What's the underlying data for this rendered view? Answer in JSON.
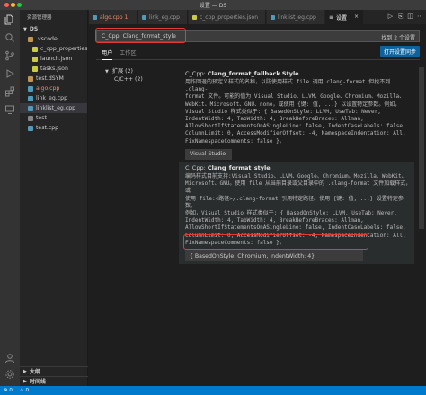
{
  "window": {
    "title": "设置 — DS"
  },
  "activity_icons": [
    "files-icon",
    "search-icon",
    "source-control-icon",
    "run-debug-icon",
    "extensions-icon",
    "remote-icon"
  ],
  "activity_bottom_icons": [
    "account-icon",
    "manage-gear-icon"
  ],
  "sidebar": {
    "header": "资源管理器",
    "folder": "DS",
    "items": [
      {
        "label": ".vscode",
        "kind": "folder",
        "indent": 1,
        "color": "#cccccc"
      },
      {
        "label": "c_cpp_properties.json",
        "kind": "json",
        "indent": 2,
        "color": "#cccccc"
      },
      {
        "label": "launch.json",
        "kind": "json",
        "indent": 2,
        "color": "#cccccc"
      },
      {
        "label": "tasks.json",
        "kind": "json",
        "indent": 2,
        "color": "#cccccc"
      },
      {
        "label": "test.dSYM",
        "kind": "folder",
        "indent": 1,
        "color": "#cccccc"
      },
      {
        "label": "algo.cpp",
        "kind": "cpp",
        "indent": 1,
        "color": "#f48771"
      },
      {
        "label": "link_eg.cpp",
        "kind": "cpp",
        "indent": 1,
        "color": "#cccccc"
      },
      {
        "label": "linklist_eg.cpp",
        "kind": "cpp",
        "indent": 1,
        "color": "#cccccc"
      },
      {
        "label": "test",
        "kind": "file",
        "indent": 1,
        "color": "#cccccc"
      },
      {
        "label": "test.cpp",
        "kind": "cpp",
        "indent": 1,
        "color": "#cccccc"
      }
    ],
    "outline": "大纲",
    "timeline": "时间线"
  },
  "tabs": [
    {
      "label": "algo.cpp 1",
      "color": "#f48771",
      "active": false
    },
    {
      "label": "link_eg.cpp",
      "color": "#969696",
      "active": false
    },
    {
      "label": "c_cpp_properties.json",
      "color": "#969696",
      "active": false
    },
    {
      "label": "linklist_eg.cpp",
      "color": "#969696",
      "active": false
    },
    {
      "label": "设置",
      "color": "#ffffff",
      "active": true,
      "close": "×"
    }
  ],
  "search": {
    "query": "C_Cpp: Clang_format_style",
    "result_count": "找到 2 个设置"
  },
  "scopes": {
    "user": "用户",
    "workspace": "工作区"
  },
  "sync_button": "打开设置同步",
  "toc": {
    "extensions": "扩展 (2)",
    "cpp": "C/C++ (2)"
  },
  "settings": [
    {
      "prefix": "C_Cpp: ",
      "name": "Clang_format_fallback Style",
      "desc": "用作回退的预定义样式的名称，以防使用样式 file 调用 clang-format 但找不到 .clang-\nformat 文件。可能的值为 Visual Studio、LLVM、Google、Chromium、Mozilla、\nWebKit、Microsoft、GNU、none，或使用 {键: 值, ...} 以设置特定参数。例如，\nVisual Studio 样式类似于: { BasedOnStyle: LLVM, UseTab: Never,\nIndentWidth: 4, TabWidth: 4, BreakBeforeBraces: Allman,\nAllowShortIfStatementsOnASingleLine: false, IndentCaseLabels: false,\nColumnLimit: 0, AccessModifierOffset: -4, NamespaceIndentation: All,\nFixNamespaceComments: false }。",
      "value": "Visual Studio"
    },
    {
      "prefix": "C_Cpp: ",
      "name": "Clang_format_style",
      "desc": "编码样式目前支持:Visual Studio、LLVM、Google、Chromium、Mozilla、WebKit、\nMicrosoft、GNU。使用 file 从当前目录或父目录中的 .clang-format 文件加载样式，或\n使用 file:<路径>/.clang-format 引用特定路径。使用 {键: 值, ...} 设置特定参数。\n例如，Visual Studio 样式类似于: { BasedOnStyle: LLVM, UseTab: Never,\nIndentWidth: 4, TabWidth: 4, BreakBeforeBraces: Allman,\nAllowShortIfStatementsOnASingleLine: false, IndentCaseLabels: false,\nColumnLimit: 0, AccessModifierOffset: -4, NamespaceIndentation: All,\nFixNamespaceComments: false }。",
      "value": "{ BasedOnStyle: Chromium, IndentWidth: 4}"
    }
  ],
  "status": {
    "errors": "⊗ 0",
    "warnings": "⚠ 0"
  },
  "colors": {
    "highlight": "#e53935",
    "accent": "#007acc",
    "button": "#0e639c"
  }
}
